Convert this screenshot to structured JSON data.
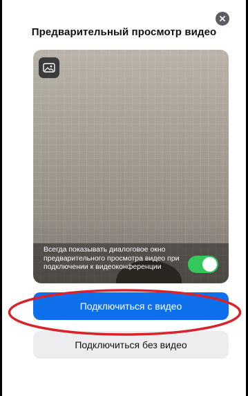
{
  "dialog": {
    "title": "Предварительный просмотр видео",
    "close_icon": "close-icon"
  },
  "preview": {
    "background_icon": "image-icon",
    "toggle_label": "Всегда показывать диалоговое окно предварительного просмотра видео при подключении к видеоконференции",
    "toggle_on": true
  },
  "actions": {
    "join_with_video": "Подключиться с видео",
    "join_without_video": "Подключиться без видео"
  },
  "colors": {
    "accent": "#0e71eb",
    "toggle_on": "#34c759",
    "annotation": "#d9232a"
  }
}
